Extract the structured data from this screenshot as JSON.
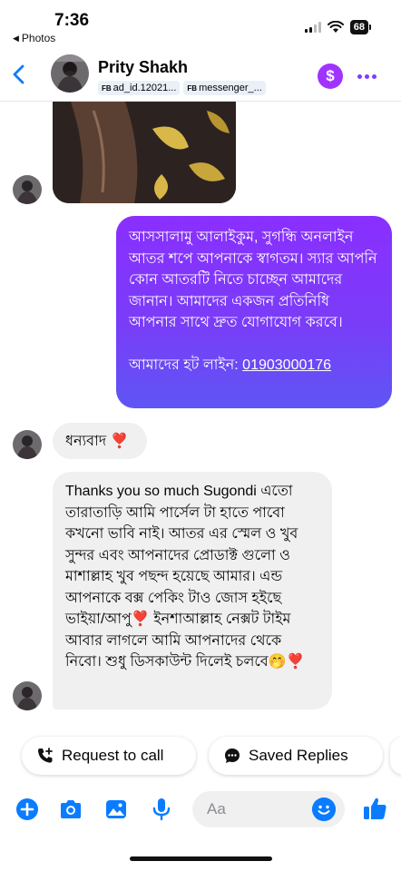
{
  "status_bar": {
    "time": "7:36",
    "back_label": "Photos",
    "battery": "68"
  },
  "header": {
    "contact_name": "Prity Shakh",
    "tags": [
      {
        "prefix": "FB",
        "text": "ad_id.12021..."
      },
      {
        "prefix": "FB",
        "text": "messenger_..."
      }
    ],
    "dollar_symbol": "$"
  },
  "messages": {
    "outgoing": {
      "body": "আসসালামু আলাইকুম, সুগন্ধি অনলাইন আতর শপে আপনাকে স্বাগতম। স্যার আপনি কোন আতরটি নিতে চাচ্ছেন আমাদের জানান। আমাদের একজন প্রতিনিধি আপনার সাথে দ্রুত যোগাযোগ করবে।",
      "hotline_label": "আমাদের হট লাইন: ",
      "hotline_number": "01903000176"
    },
    "incoming_thanks": "ধন্যবাদ ❣️",
    "incoming_long": "Thanks you so much Sugondi এতো তারাতাড়ি আমি পার্সেল টা হাতে পাবো কখনো ভাবি নাই।  আতর এর স্মেল ও খুব সুন্দর এবং আপনাদের প্রোডাক্ট গুলো ও মাশাল্লাহ খুব পছন্দ হয়েছে আমার। এন্ড আপনাকে বক্স পেকিং টাও জোস হইছে  ভাইয়া/আপু❣️ ইনশাআল্লাহ নেক্সট টাইম আবার লাগলে আমি আপনাদের থেকে নিবো। শুধু ডিসকাউন্ট দিলেই চলবে🤭❣️"
  },
  "quick_replies": {
    "request_call": "Request to call",
    "saved_replies": "Saved Replies"
  },
  "composer": {
    "placeholder": "Aa"
  },
  "colors": {
    "accent": "#0a7cff",
    "outgoing_top": "#8a2fff",
    "outgoing_bottom": "#5e56f4",
    "incoming_bg": "#f0f0f0",
    "dollar": "#a033ff"
  },
  "icons": [
    "chevron-left-icon",
    "signal-icon",
    "wifi-icon",
    "battery-icon",
    "dollar-icon",
    "more-icon",
    "phone-plus-icon",
    "chat-bubble-icon",
    "plus-icon",
    "camera-icon",
    "image-icon",
    "microphone-icon",
    "emoji-icon",
    "thumbs-up-icon"
  ]
}
